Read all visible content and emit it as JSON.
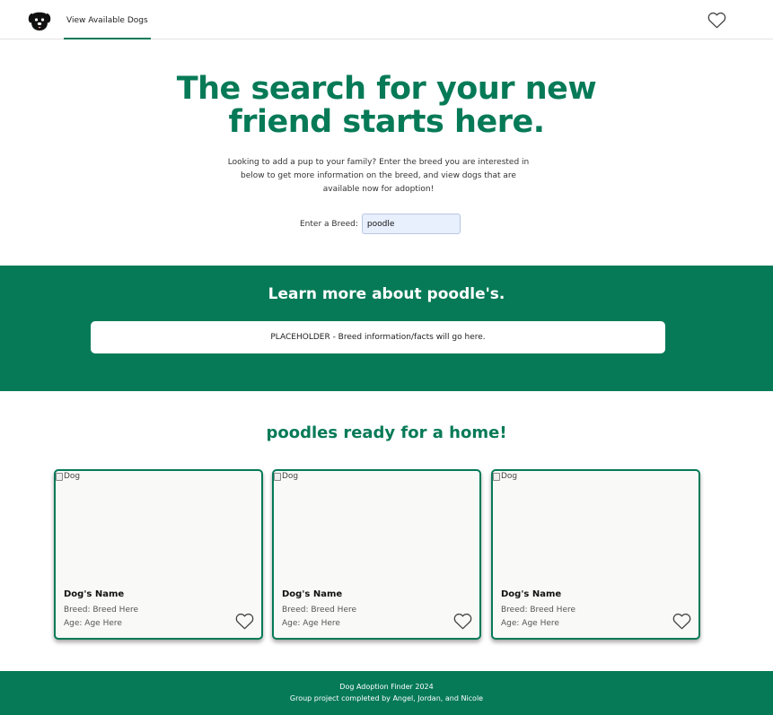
{
  "nav": {
    "logo_icon": "dog-face-icon",
    "link_label": "View Available Dogs",
    "favorites_icon": "heart-outline-icon"
  },
  "hero": {
    "title": "The search for your new friend starts here.",
    "description": "Looking to add a pup to your family? Enter the breed you are interested in below to get more information on the breed, and view dogs that are available now for adoption!",
    "breed_label": "Enter a Breed:",
    "breed_value": "poodle"
  },
  "info": {
    "title": "Learn more about poodle's.",
    "placeholder_text": "PLACEHOLDER - Breed information/facts will go here."
  },
  "listings": {
    "title": "poodles ready for a home!",
    "cards": [
      {
        "image_alt": "Dog",
        "name": "Dog's Name",
        "breed": "Breed: Breed Here",
        "age": "Age: Age Here"
      },
      {
        "image_alt": "Dog",
        "name": "Dog's Name",
        "breed": "Breed: Breed Here",
        "age": "Age: Age Here"
      },
      {
        "image_alt": "Dog",
        "name": "Dog's Name",
        "breed": "Breed: Breed Here",
        "age": "Age: Age Here"
      }
    ]
  },
  "footer": {
    "line1": "Dog Adoption Finder 2024",
    "line2": "Group project completed by Angel, Jordan, and Nicole"
  },
  "colors": {
    "brand_green": "#067a57",
    "input_background": "#e8effd",
    "card_background": "#f9f9f7"
  }
}
